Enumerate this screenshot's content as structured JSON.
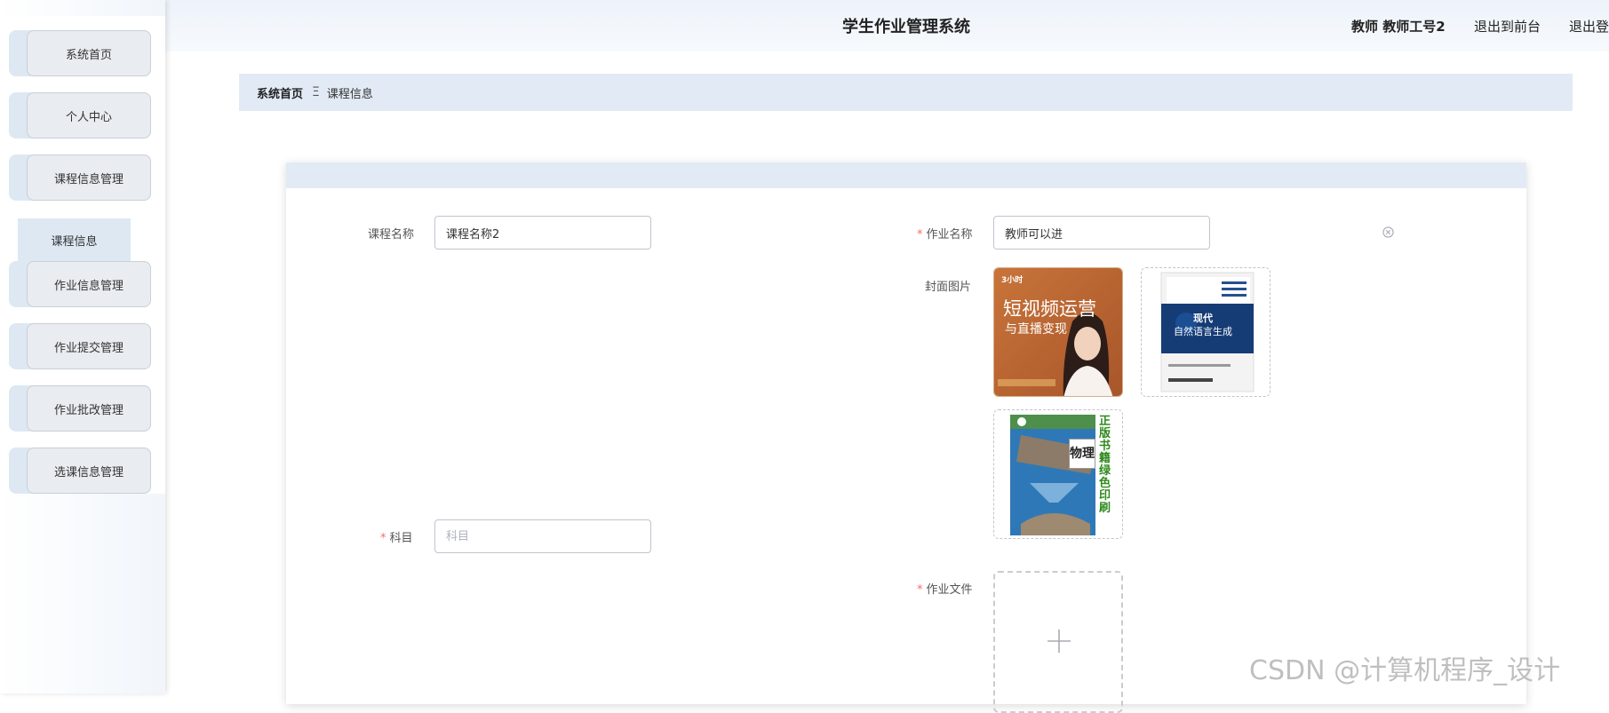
{
  "header": {
    "title": "学生作业管理系统",
    "user_info": "教师 教师工号2",
    "links": [
      "退出到前台",
      "退出登录"
    ]
  },
  "sidebar": {
    "items": [
      {
        "label": "系统首页"
      },
      {
        "label": "个人中心"
      },
      {
        "label": "课程信息管理"
      },
      {
        "label": "作业信息管理"
      },
      {
        "label": "作业提交管理"
      },
      {
        "label": "作业批改管理"
      },
      {
        "label": "选课信息管理"
      }
    ],
    "sub_item": "课程信息"
  },
  "breadcrumb": {
    "home": "系统首页",
    "separator": "Ξ",
    "current": "课程信息"
  },
  "form": {
    "course_name": {
      "label": "课程名称",
      "value": "课程名称2"
    },
    "homework_name": {
      "label": "作业名称",
      "value": "教师可以进"
    },
    "cover": {
      "label": "封面图片",
      "images": [
        {
          "title": "短视频运营",
          "subtitle": "与直播变现",
          "brand": "3小时"
        },
        {
          "title": "现代",
          "subtitle": "自然语言生成"
        },
        {
          "title": "物理",
          "side_text": "正版书籍 绿色印刷"
        }
      ]
    },
    "subject": {
      "label": "科目",
      "placeholder": "科目"
    },
    "homework_file": {
      "label": "作业文件"
    }
  },
  "watermark": "CSDN @计算机程序_设计",
  "colors": {
    "accent_bg": "#e2ebf5",
    "required": "#f56c6c",
    "border": "#c0c4cc"
  }
}
